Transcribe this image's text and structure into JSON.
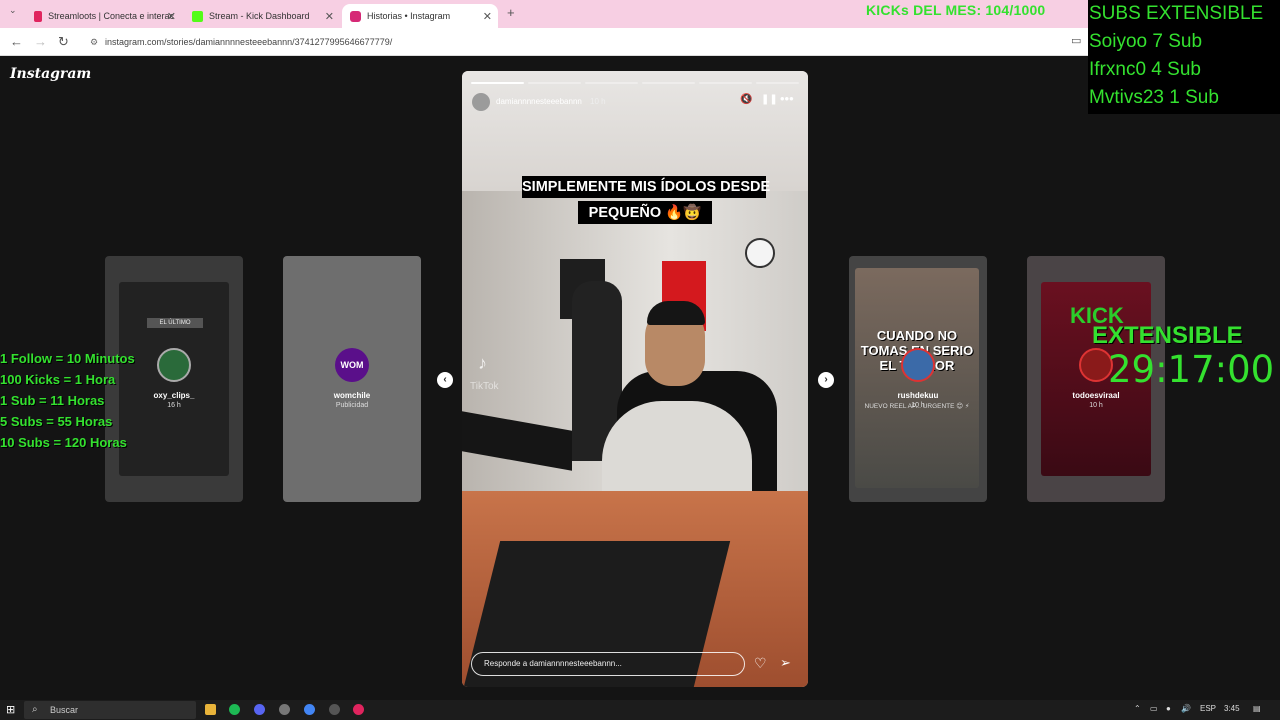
{
  "browser": {
    "tabs": [
      {
        "label": "Streamloots | Conecta e interac",
        "color": "#e0245e"
      },
      {
        "label": "Stream - Kick Dashboard",
        "color": "#53fc18"
      },
      {
        "label": "Historias • Instagram",
        "color": "#d62976"
      }
    ],
    "url": "instagram.com/stories/damiannnnesteeebannn/3741277995646677779/"
  },
  "instagram": {
    "logo": "Instagram",
    "main_story": {
      "username": "damiannnnesteeebannn",
      "time": "10 h",
      "caption_line1": "SIMPLEMENTE MIS ÍDOLOS DESDE",
      "caption_line2": "PEQUEÑO 🔥🤠",
      "tiktok_label": "TikTok",
      "reply_placeholder": "Responde a damiannnnesteeebannn..."
    },
    "side_stories": [
      {
        "name": "oxy_clips_",
        "time": "16 h",
        "inner_label": "EL ÚLTIMO"
      },
      {
        "name": "womchile",
        "time": "Publicidad",
        "avatar_text": "WOM"
      },
      {
        "name": "rushdekuu",
        "time": "10 h",
        "inner_text": "CUANDO NO TOMAS EN SERIO EL TERROR",
        "inner_caption": "NUEVO REEL AP... URGENTE 😊 ⚡"
      },
      {
        "name": "todoesviraal",
        "time": "10 h"
      }
    ]
  },
  "overlay": {
    "kicks_mes": "KICKs DEL MES: 104/1000",
    "subs_title": "SUBS EXTENSIBLE",
    "subs": [
      "Soiyoo 7 Sub",
      "Ifrxnc0 4 Sub",
      "Mvtivs23 1 Sub"
    ],
    "rules": [
      "1 Follow = 10 Minutos",
      "100 Kicks = 1 Hora",
      "1 Sub = 11 Horas",
      "5 Subs = 55 Horas",
      "10 Subs = 120 Horas"
    ],
    "kick_label": "KICK",
    "extensible_label": "EXTENSIBLE",
    "timer": "29:17:00"
  },
  "taskbar": {
    "search_placeholder": "Buscar",
    "lang": "ESP",
    "clock": "3:45"
  }
}
